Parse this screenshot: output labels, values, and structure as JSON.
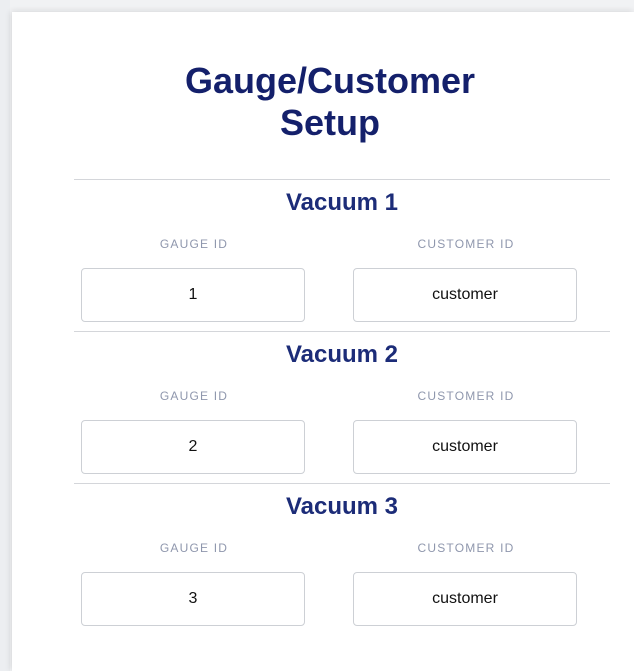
{
  "title": "Gauge/Customer Setup",
  "title_line1": "Gauge/Customer",
  "title_line2": "Setup",
  "sections": [
    {
      "heading": "Vacuum 1",
      "gauge_label": "GAUGE ID",
      "customer_label": "CUSTOMER ID",
      "gauge_value": "1",
      "customer_value": "customer"
    },
    {
      "heading": "Vacuum 2",
      "gauge_label": "GAUGE ID",
      "customer_label": "CUSTOMER ID",
      "gauge_value": "2",
      "customer_value": "customer"
    },
    {
      "heading": "Vacuum 3",
      "gauge_label": "GAUGE ID",
      "customer_label": "CUSTOMER ID",
      "gauge_value": "3",
      "customer_value": "customer"
    }
  ],
  "colors": {
    "title": "#14206b",
    "heading": "#1c2c78",
    "label": "#8f97ad",
    "divider": "#d4d6da",
    "input_border": "#cdd0d5"
  }
}
